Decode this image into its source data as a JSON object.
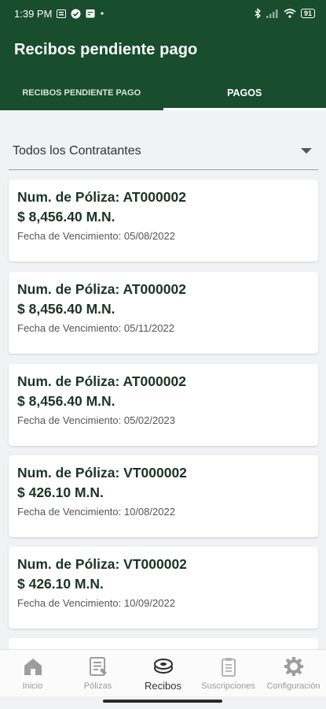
{
  "status_bar": {
    "time": "1:39 PM",
    "battery": "91"
  },
  "app_bar": {
    "title": "Recibos pendiente pago"
  },
  "tabs": [
    {
      "label": "RECIBOS PENDIENTE PAGO"
    },
    {
      "label": "PAGOS"
    }
  ],
  "filter": {
    "selected": "Todos los Contratantes"
  },
  "receipts": [
    {
      "poliza": "Num. de Póliza: AT000002",
      "monto": "$ 8,456.40 M.N.",
      "fecha": "Fecha de Vencimiento: 05/08/2022"
    },
    {
      "poliza": "Num. de Póliza: AT000002",
      "monto": "$ 8,456.40 M.N.",
      "fecha": "Fecha de Vencimiento: 05/11/2022"
    },
    {
      "poliza": "Num. de Póliza: AT000002",
      "monto": "$ 8,456.40 M.N.",
      "fecha": "Fecha de Vencimiento: 05/02/2023"
    },
    {
      "poliza": "Num. de Póliza: VT000002",
      "monto": "$ 426.10 M.N.",
      "fecha": "Fecha de Vencimiento: 10/08/2022"
    },
    {
      "poliza": "Num. de Póliza: VT000002",
      "monto": "$ 426.10 M.N.",
      "fecha": "Fecha de Vencimiento: 10/09/2022"
    }
  ],
  "bottom_nav": [
    {
      "label": "Inicio",
      "icon": "home-icon"
    },
    {
      "label": "Pólizas",
      "icon": "policies-icon"
    },
    {
      "label": "Recibos",
      "icon": "receipts-icon"
    },
    {
      "label": "Suscripciones",
      "icon": "subscriptions-icon"
    },
    {
      "label": "Configuración",
      "icon": "gear-icon"
    }
  ],
  "colors": {
    "brand": "#184d2d",
    "background": "#f1f2f3"
  }
}
